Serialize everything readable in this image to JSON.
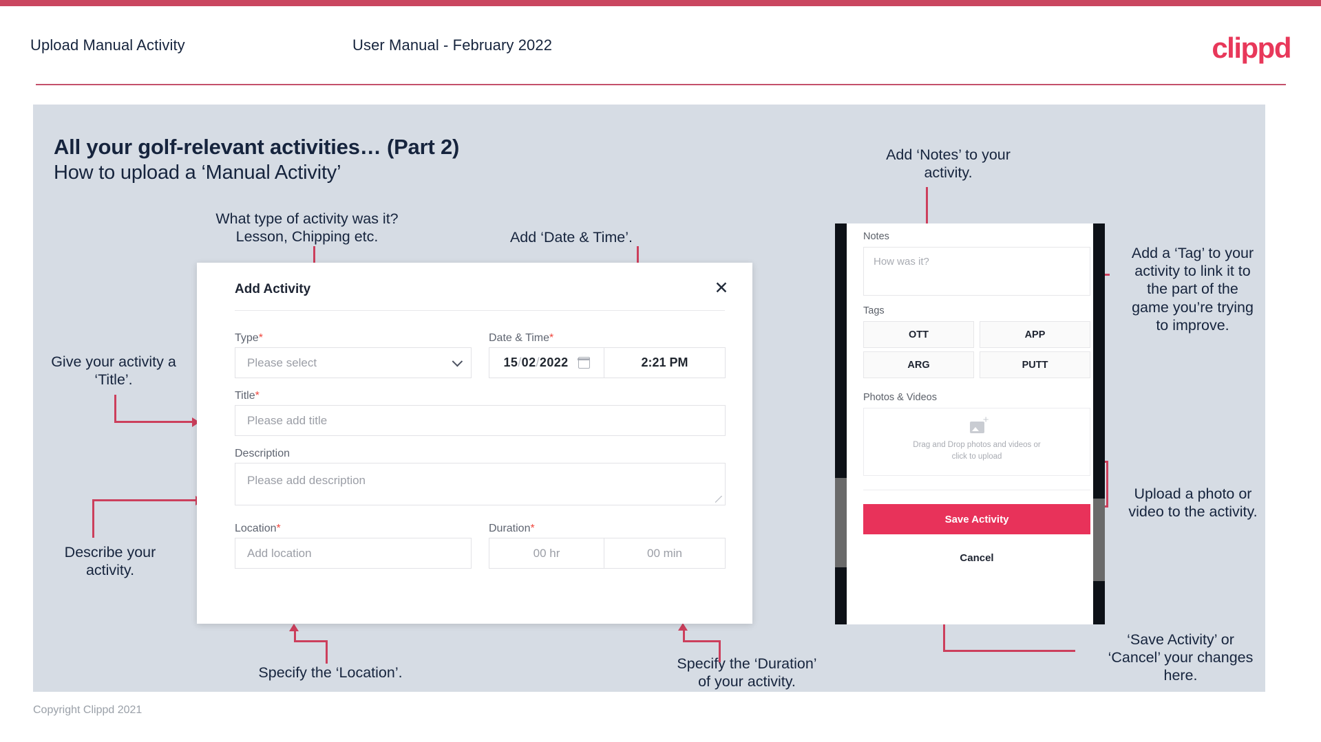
{
  "header": {
    "title": "Upload Manual Activity",
    "subtitle": "User Manual - February 2022",
    "logo": "clippd"
  },
  "slide": {
    "title": "All your golf-relevant activities… (Part 2)",
    "subtitle": "How to upload a ‘Manual Activity’"
  },
  "annotations": {
    "type": "What type of activity was it?\nLesson, Chipping etc.",
    "datetime": "Add ‘Date & Time’.",
    "title": "Give your activity a\n‘Title’.",
    "description": "Describe your\nactivity.",
    "location": "Specify the ‘Location’.",
    "duration": "Specify the ‘Duration’\nof your activity.",
    "notes": "Add ‘Notes’ to your\nactivity.",
    "tags": "Add a ‘Tag’ to your\nactivity to link it to\nthe part of the\ngame you’re trying\nto improve.",
    "upload": "Upload a photo or\nvideo to the activity.",
    "save": "‘Save Activity’ or\n‘Cancel’ your changes\nhere."
  },
  "dialog": {
    "title": "Add Activity",
    "close_icon": "close-icon",
    "fields": {
      "type_label": "Type",
      "type_placeholder": "Please select",
      "datetime_label": "Date & Time",
      "date_day": "15",
      "date_month": "02",
      "date_year": "2022",
      "date_sep": "/",
      "time_value": "2:21 PM",
      "title_label": "Title",
      "title_placeholder": "Please add title",
      "description_label": "Description",
      "description_placeholder": "Please add description",
      "location_label": "Location",
      "location_placeholder": "Add location",
      "duration_label": "Duration",
      "duration_hr": "00 hr",
      "duration_min": "00 min",
      "required_mark": "*"
    }
  },
  "phone": {
    "notes_label": "Notes",
    "notes_placeholder": "How was it?",
    "tags_label": "Tags",
    "tags": [
      "OTT",
      "APP",
      "ARG",
      "PUTT"
    ],
    "photos_label": "Photos & Videos",
    "dropzone_text": "Drag and Drop photos and videos or click to upload",
    "save_label": "Save Activity",
    "cancel_label": "Cancel"
  },
  "footer": {
    "copyright": "Copyright Clippd 2021"
  },
  "colors": {
    "accent": "#ca4760",
    "brand_pink": "#e8385a",
    "slide_bg": "#d6dce4",
    "text_dark": "#16243d",
    "connector": "#cc3f5c"
  }
}
